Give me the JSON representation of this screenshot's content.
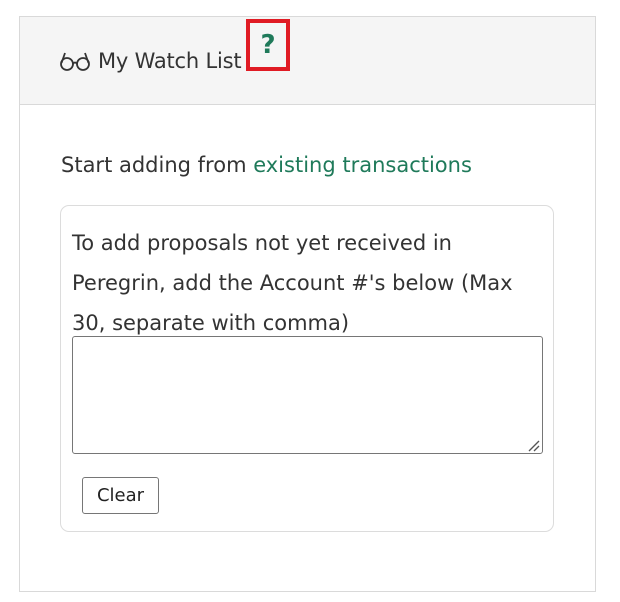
{
  "header": {
    "icon": "glasses-icon",
    "title": "My Watch List",
    "help_icon": "question-mark-icon",
    "help_glyph": "?"
  },
  "intro": {
    "prefix": "Start adding from ",
    "link_text": "existing transactions"
  },
  "card": {
    "instructions": "To add proposals not yet received in Peregrin, add the Account #'s below (Max 30, separate with comma)",
    "textarea_value": "",
    "clear_label": "Clear"
  },
  "colors": {
    "accent": "#1f7a5a",
    "highlight_border": "#e01b24",
    "header_bg": "#f5f5f5"
  }
}
